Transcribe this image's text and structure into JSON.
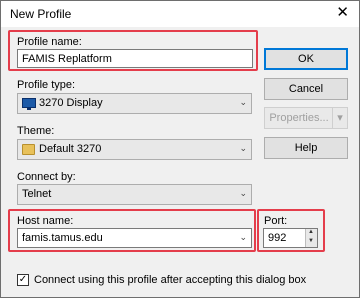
{
  "window": {
    "title": "New Profile",
    "close_glyph": "✕"
  },
  "profile_name": {
    "label": "Profile name:",
    "value": "FAMIS Replatform"
  },
  "profile_type": {
    "label": "Profile type:",
    "value": "3270 Display",
    "icon": "monitor-icon"
  },
  "theme": {
    "label": "Theme:",
    "value": "Default 3270",
    "icon": "folder-icon"
  },
  "connect_by": {
    "label": "Connect by:",
    "value": "Telnet"
  },
  "host_name": {
    "label": "Host name:",
    "value": "famis.tamus.edu"
  },
  "port": {
    "label": "Port:",
    "value": "992"
  },
  "buttons": {
    "ok": "OK",
    "cancel": "Cancel",
    "properties": "Properties...",
    "help": "Help"
  },
  "connect_checkbox": {
    "label": "Connect using this profile after accepting this dialog box",
    "checked": true,
    "check_glyph": "✓"
  },
  "glyphs": {
    "chevron_down": "⌄",
    "spin_up": "▲",
    "spin_down": "▼",
    "split_down": "▾"
  },
  "colors": {
    "highlight": "#e43d4b",
    "default_button_border": "#0078d7"
  }
}
